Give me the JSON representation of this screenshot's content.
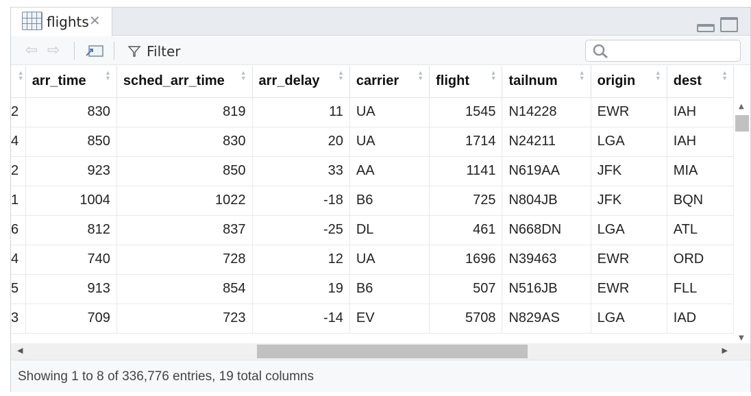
{
  "tab": {
    "title": "flights"
  },
  "toolbar": {
    "filter_label": "Filter",
    "search_placeholder": ""
  },
  "columns": [
    "",
    "arr_time",
    "sched_arr_time",
    "arr_delay",
    "carrier",
    "flight",
    "tailnum",
    "origin",
    "dest"
  ],
  "rows": [
    [
      "2",
      "830",
      "819",
      "11",
      "UA",
      "1545",
      "N14228",
      "EWR",
      "IAH"
    ],
    [
      "4",
      "850",
      "830",
      "20",
      "UA",
      "1714",
      "N24211",
      "LGA",
      "IAH"
    ],
    [
      "2",
      "923",
      "850",
      "33",
      "AA",
      "1141",
      "N619AA",
      "JFK",
      "MIA"
    ],
    [
      "1",
      "1004",
      "1022",
      "-18",
      "B6",
      "725",
      "N804JB",
      "JFK",
      "BQN"
    ],
    [
      "6",
      "812",
      "837",
      "-25",
      "DL",
      "461",
      "N668DN",
      "LGA",
      "ATL"
    ],
    [
      "4",
      "740",
      "728",
      "12",
      "UA",
      "1696",
      "N39463",
      "EWR",
      "ORD"
    ],
    [
      "5",
      "913",
      "854",
      "19",
      "B6",
      "507",
      "N516JB",
      "EWR",
      "FLL"
    ],
    [
      "3",
      "709",
      "723",
      "-14",
      "EV",
      "5708",
      "N829AS",
      "LGA",
      "IAD"
    ]
  ],
  "status": {
    "text": "Showing 1 to 8 of 336,776 entries, 19 total columns"
  },
  "colors": {
    "accent": "#c1c1c1",
    "border": "#d0d4d8"
  }
}
